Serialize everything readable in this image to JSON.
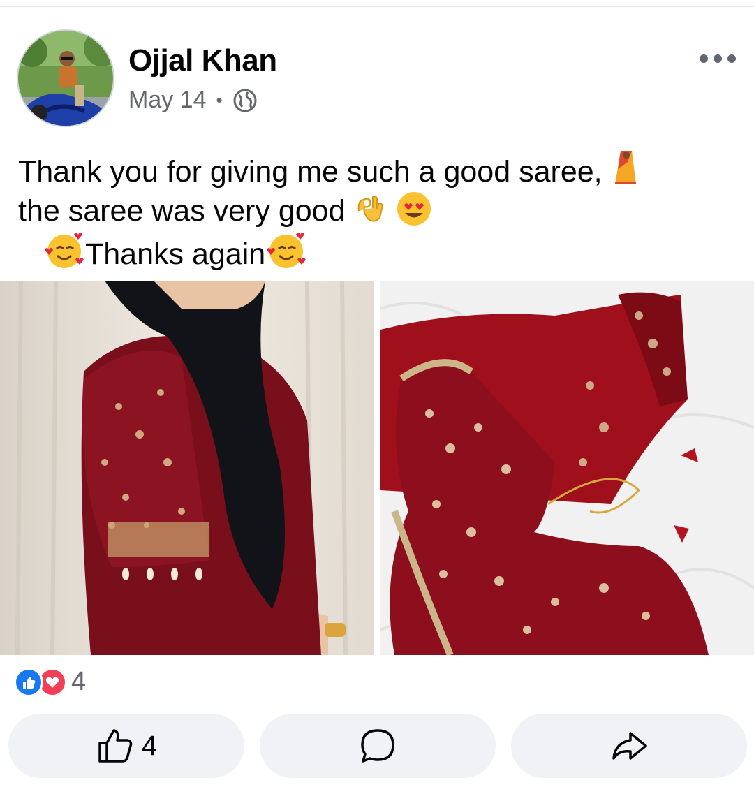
{
  "post": {
    "author": "Ojjal Khan",
    "date": "May 14",
    "separator": "•",
    "privacy_icon": "globe-icon",
    "text_line1": "Thank you for giving me such a good saree,",
    "text_line2": "the saree was very good",
    "text_line3": "Thanks again",
    "emojis": [
      "saree-emoji",
      "ok-hand-emoji",
      "heart-eyes-emoji",
      "smiling-face-with-hearts-emoji"
    ]
  },
  "photos": [
    {
      "alt": "woman-in-maroon-embroidered-blouse"
    },
    {
      "alt": "maroon-velvet-saree-and-blouse"
    }
  ],
  "reactions": {
    "types": [
      "like",
      "love"
    ],
    "count": "4"
  },
  "actions": {
    "like_count": "4",
    "comment_icon": "comment-icon",
    "share_icon": "share-icon"
  },
  "colors": {
    "like_blue": "#1877f2",
    "love_red": "#f33e58",
    "secondary_text": "#65676b",
    "button_bg": "#f0f2f5",
    "maroon": "#7a0f1c"
  }
}
